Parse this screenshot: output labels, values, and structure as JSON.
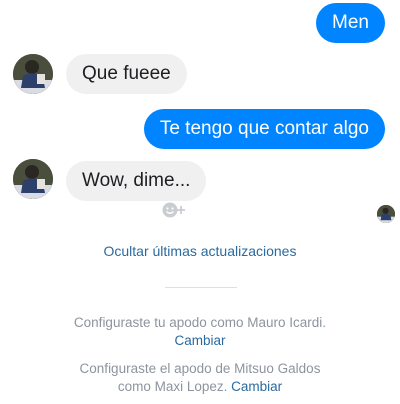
{
  "messages": [
    {
      "direction": "outgoing",
      "text": "Men"
    },
    {
      "direction": "incoming",
      "text": "Que fueee"
    },
    {
      "direction": "outgoing",
      "text": "Te tengo que contar algo"
    },
    {
      "direction": "incoming",
      "text": "Wow, dime..."
    }
  ],
  "updates_link": "Ocultar últimas actualizaciones",
  "notices": [
    {
      "line1": "Configuraste tu apodo como Mauro Icardi.",
      "action": "Cambiar"
    },
    {
      "line1": "Configuraste el apodo de Mitsuo Galdos",
      "line2": "como Maxi Lopez.",
      "action": "Cambiar"
    }
  ],
  "icons": {
    "reaction": "add-reaction-icon",
    "avatar": "contact-avatar-icon",
    "seen": "seen-avatar-icon"
  },
  "colors": {
    "outgoing_bubble": "#0084ff",
    "incoming_bubble": "#f1f0f0",
    "link": "#2b6a9e",
    "notice_text": "#8d949e"
  }
}
